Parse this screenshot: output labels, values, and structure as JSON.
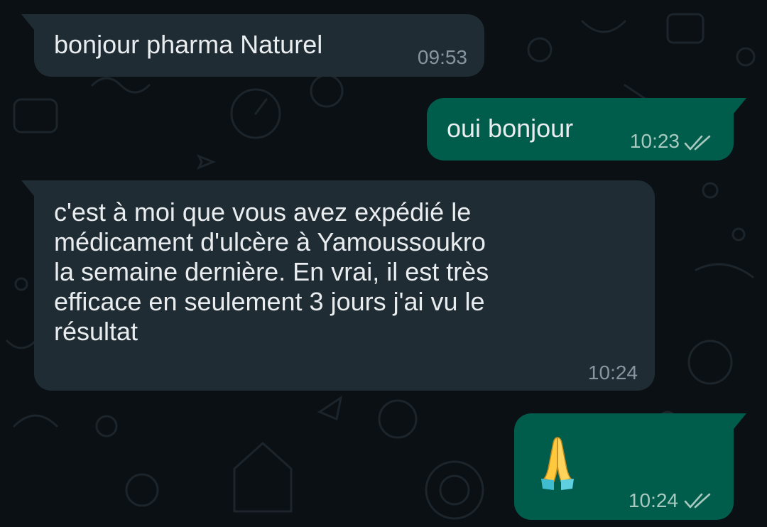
{
  "chat": {
    "messages": [
      {
        "direction": "incoming",
        "text": "bonjour pharma Naturel",
        "time": "09:53"
      },
      {
        "direction": "outgoing",
        "text": "oui bonjour",
        "time": "10:23",
        "status": "read"
      },
      {
        "direction": "incoming",
        "text": "c'est à moi que vous avez expédié le\nmédicament d'ulcère à Yamoussoukro\nla semaine dernière. En vrai, il est très\nefficace en seulement 3 jours j'ai vu le\nrésultat",
        "time": "10:24"
      },
      {
        "direction": "outgoing",
        "emoji": "folded-hands",
        "time": "10:24",
        "status": "read"
      }
    ]
  },
  "colors": {
    "background": "#0b1014",
    "incoming_bubble": "#202c33",
    "outgoing_bubble": "#005c4b",
    "text": "#e9edef",
    "timestamp": "#8696a0",
    "read_ticks": "#a8c9c0"
  },
  "icons": {
    "read_receipt": "double-check-icon",
    "emoji": "folded-hands-emoji"
  }
}
